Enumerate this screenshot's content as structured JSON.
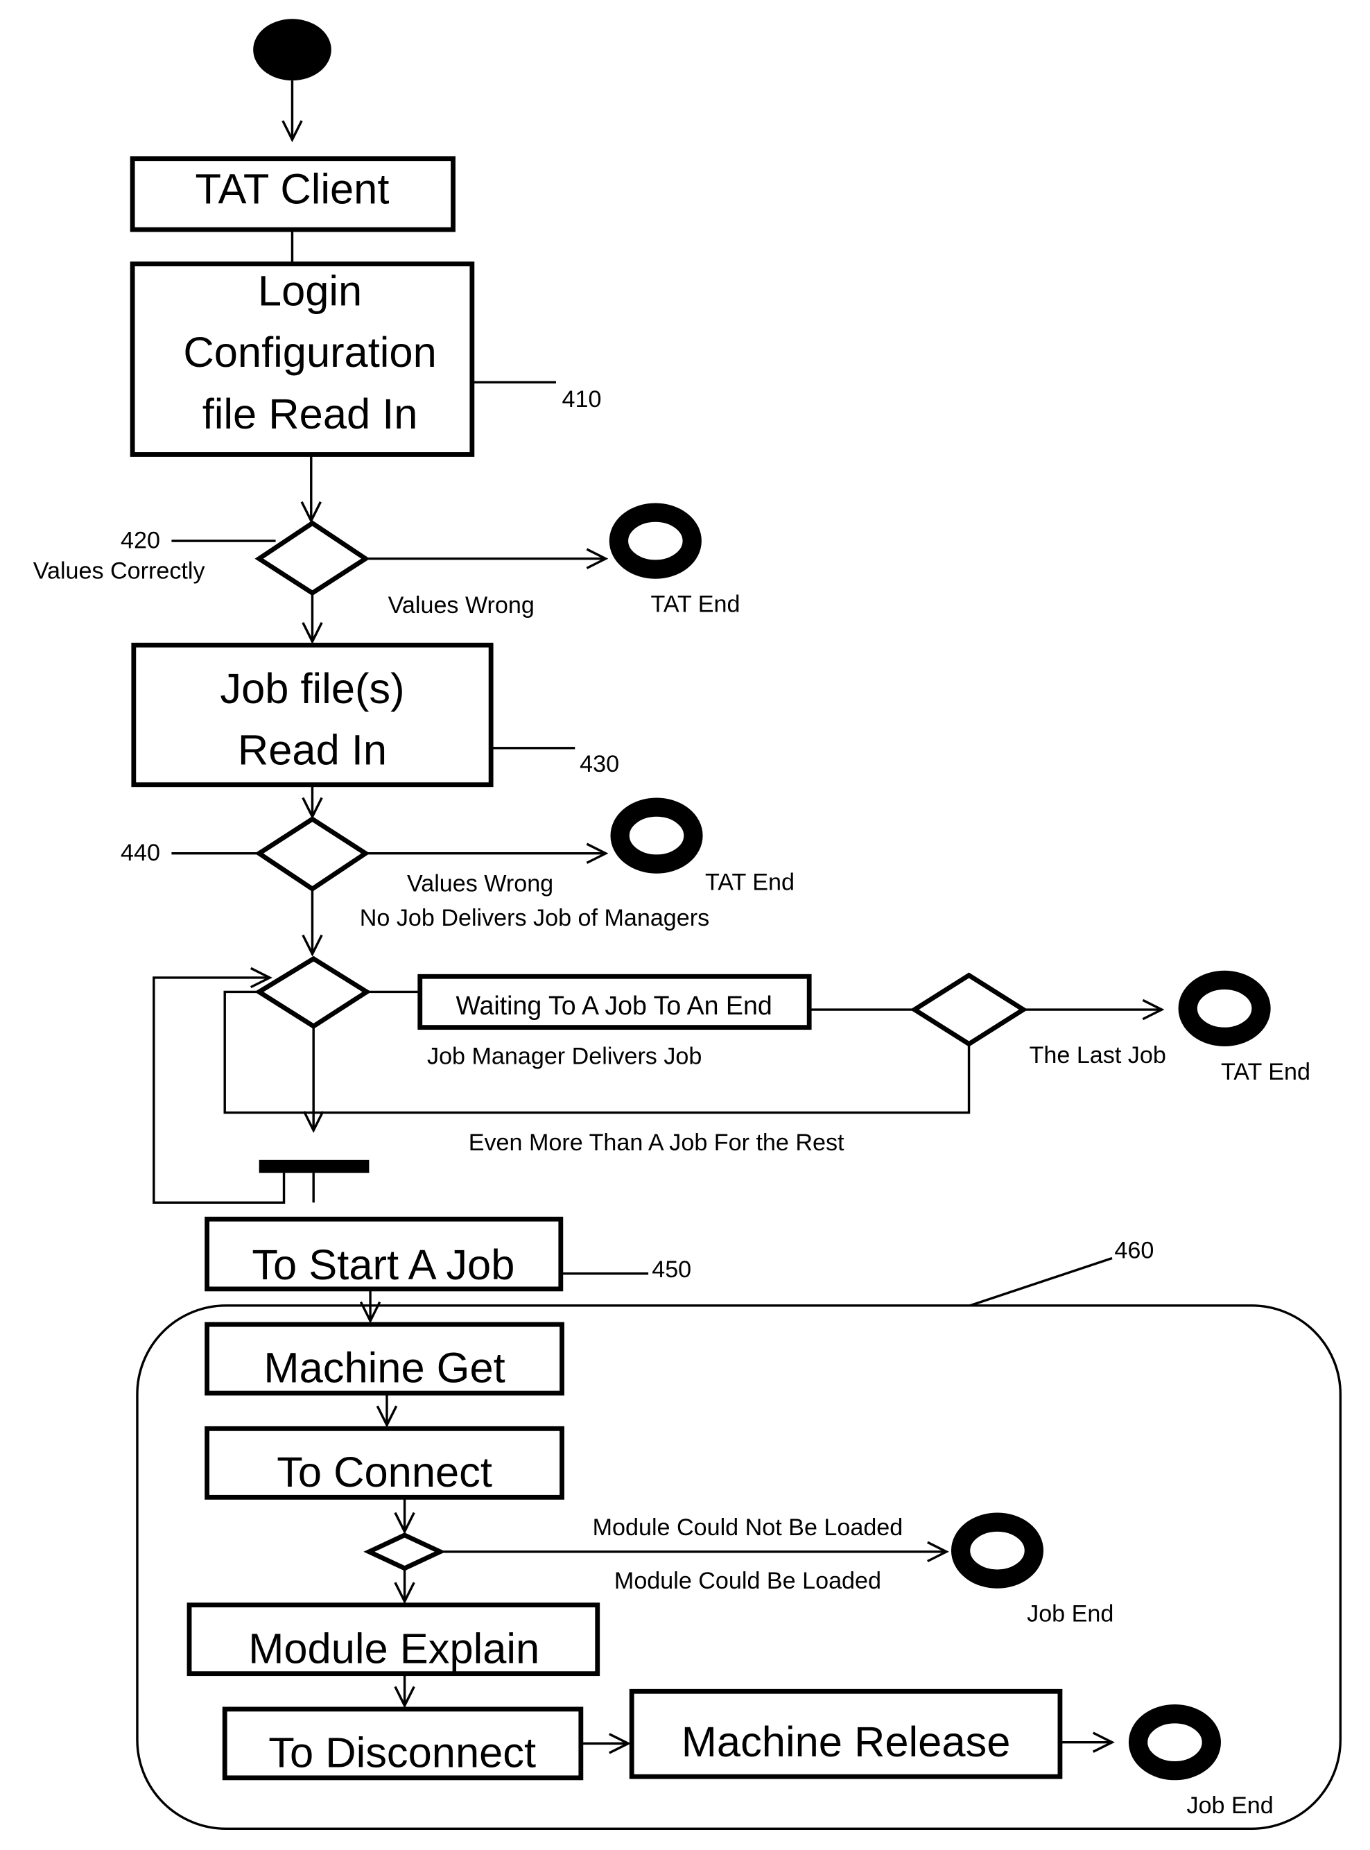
{
  "diagram": {
    "type": "activity-flowchart",
    "nodes": {
      "tat_client": "TAT Client",
      "login_config": [
        "Login",
        "Configuration",
        "file Read In"
      ],
      "job_files": [
        "Job file(s)",
        "Read In"
      ],
      "waiting": "Waiting To A Job To An End",
      "start_job": "To Start A Job",
      "machine_get": "Machine Get",
      "connect": "To Connect",
      "module_explain": "Module Explain",
      "disconnect": "To Disconnect",
      "machine_release": "Machine Release"
    },
    "refs": {
      "r410": "410",
      "r420": "420",
      "r430": "430",
      "r440": "440",
      "r450": "450",
      "r460": "460"
    },
    "labels": {
      "values_correctly": "Values Correctly",
      "values_wrong_1": "Values Wrong",
      "tat_end_1": "TAT End",
      "values_wrong_2": "Values Wrong",
      "tat_end_2": "TAT End",
      "no_job": "No Job Delivers Job of Managers",
      "job_manager_delivers": "Job Manager Delivers Job",
      "last_job": "The Last Job",
      "tat_end_3": "TAT End",
      "more_than_job": "Even More Than A Job For the Rest",
      "module_not_loaded": "Module Could Not Be Loaded",
      "module_loaded": "Module Could Be Loaded",
      "job_end_1": "Job End",
      "job_end_2": "Job End"
    }
  }
}
